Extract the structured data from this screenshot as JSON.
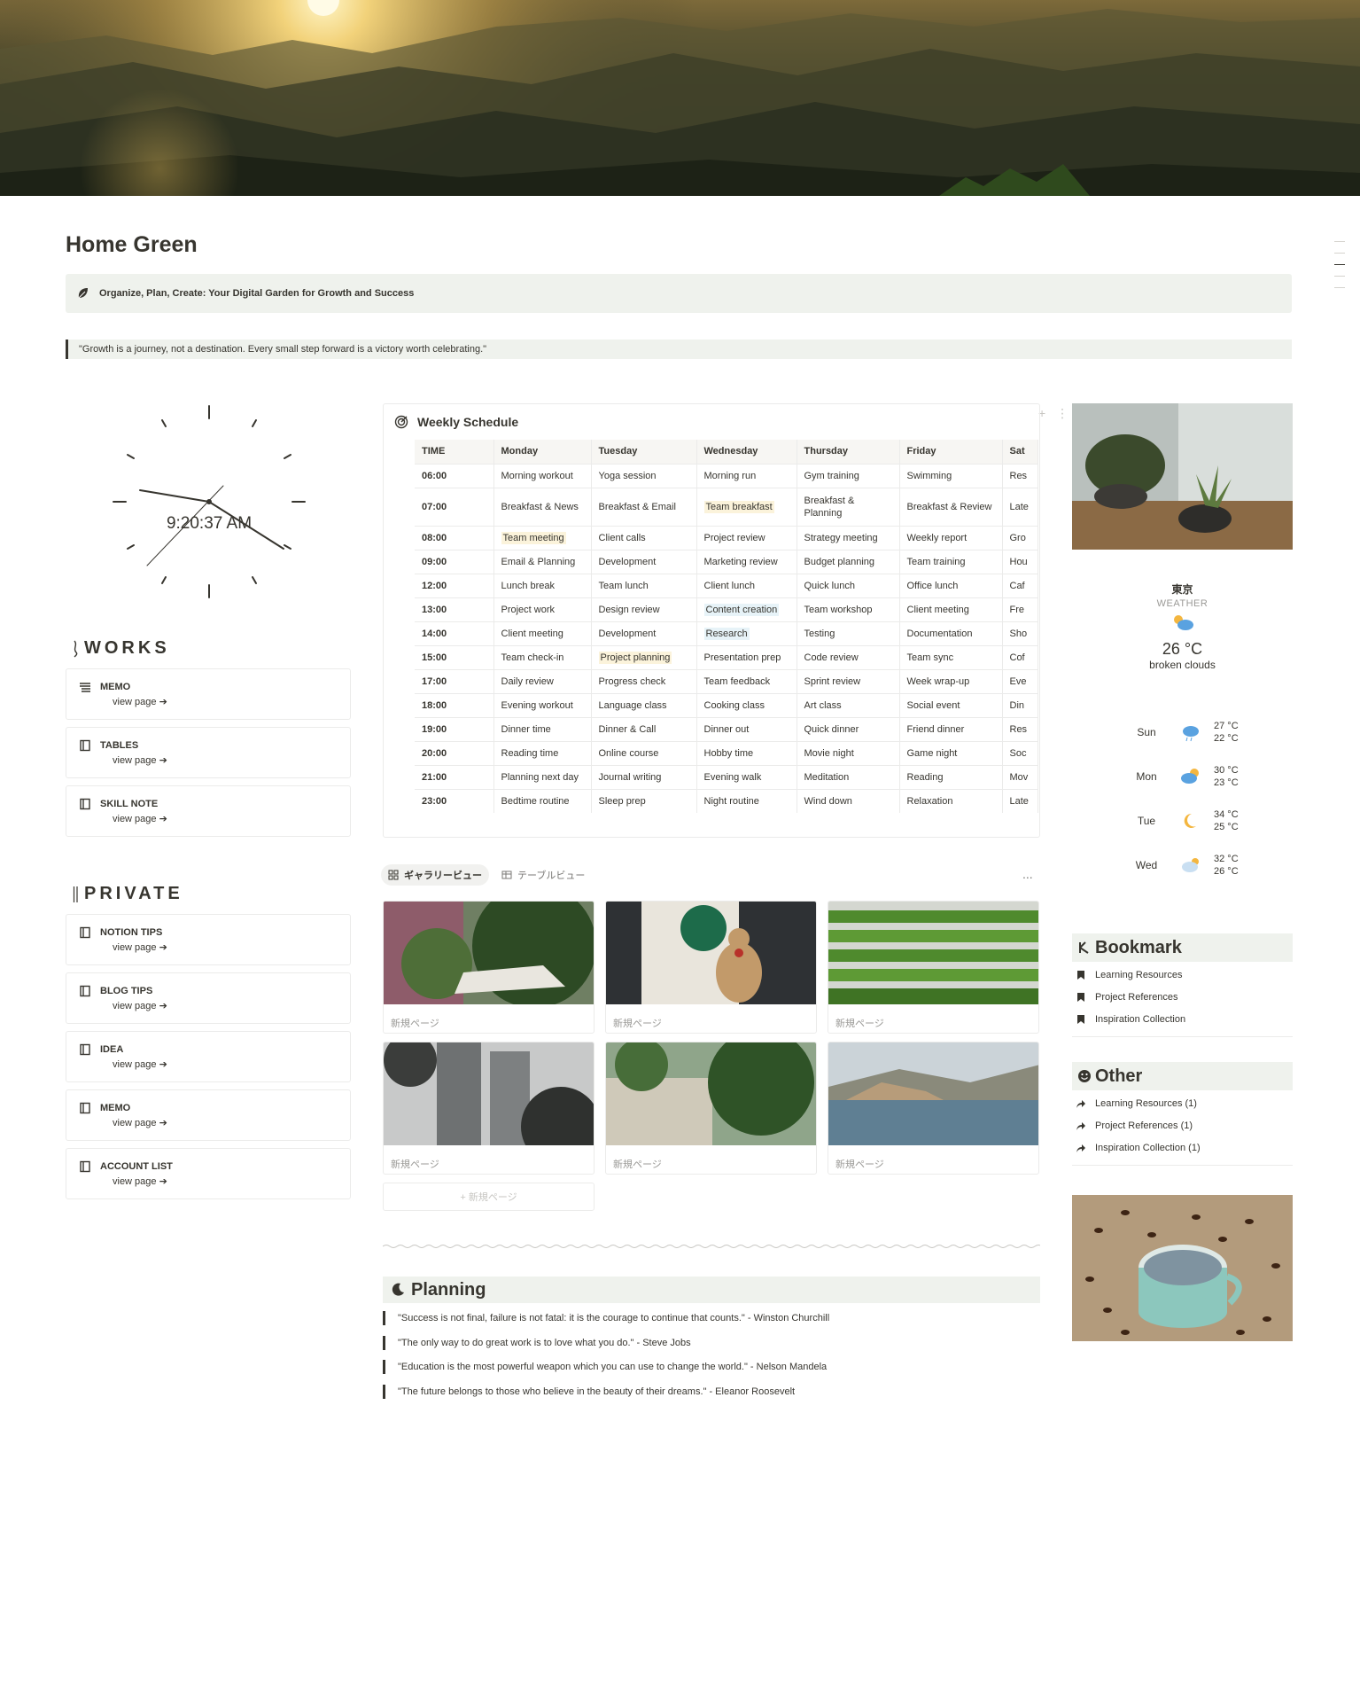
{
  "page": {
    "title": "Home Green",
    "callout": "Organize, Plan, Create: Your Digital Garden for Growth and Success",
    "quote": "\"Growth is a journey, not a destination. Every small step forward is a victory worth celebrating.\""
  },
  "clock": {
    "time": "9:20:37 AM"
  },
  "works": {
    "heading": "WORKS",
    "items": [
      {
        "label": "MEMO",
        "link": "view page ➔",
        "icon": "list-icon"
      },
      {
        "label": "TABLES",
        "link": "view page ➔",
        "icon": "book-icon"
      },
      {
        "label": "SKILL NOTE",
        "link": "view page ➔",
        "icon": "book-icon"
      }
    ]
  },
  "private": {
    "heading": "PRIVATE",
    "items": [
      {
        "label": "NOTION TIPS",
        "link": "view page ➔"
      },
      {
        "label": "BLOG TIPS",
        "link": "view page ➔"
      },
      {
        "label": "IDEA",
        "link": "view page ➔"
      },
      {
        "label": "MEMO",
        "link": "view page ➔"
      },
      {
        "label": "ACCOUNT LIST",
        "link": "view page ➔"
      }
    ]
  },
  "schedule": {
    "title": "Weekly Schedule",
    "headers": [
      "TIME",
      "Monday",
      "Tuesday",
      "Wednesday",
      "Thursday",
      "Friday",
      "Sat"
    ],
    "rows": [
      [
        "06:00",
        "Morning workout",
        "Yoga session",
        "Morning run",
        "Gym training",
        "Swimming",
        "Res"
      ],
      [
        "07:00",
        "Breakfast & News",
        "Breakfast & Email",
        "Team breakfast",
        "Breakfast & Planning",
        "Breakfast & Review",
        "Late"
      ],
      [
        "08:00",
        "Team meeting",
        "Client calls",
        "Project review",
        "Strategy meeting",
        "Weekly report",
        "Gro"
      ],
      [
        "09:00",
        "Email & Planning",
        "Development",
        "Marketing review",
        "Budget planning",
        "Team training",
        "Hou"
      ],
      [
        "12:00",
        "Lunch break",
        "Team lunch",
        "Client lunch",
        "Quick lunch",
        "Office lunch",
        "Caf"
      ],
      [
        "13:00",
        "Project work",
        "Design review",
        "Content creation",
        "Team workshop",
        "Client meeting",
        "Fre"
      ],
      [
        "14:00",
        "Client meeting",
        "Development",
        "Research",
        "Testing",
        "Documentation",
        "Sho"
      ],
      [
        "15:00",
        "Team check-in",
        "Project planning",
        "Presentation prep",
        "Code review",
        "Team sync",
        "Cof"
      ],
      [
        "17:00",
        "Daily review",
        "Progress check",
        "Team feedback",
        "Sprint review",
        "Week wrap-up",
        "Eve"
      ],
      [
        "18:00",
        "Evening workout",
        "Language class",
        "Cooking class",
        "Art class",
        "Social event",
        "Din"
      ],
      [
        "19:00",
        "Dinner time",
        "Dinner & Call",
        "Dinner out",
        "Quick dinner",
        "Friend dinner",
        "Res"
      ],
      [
        "20:00",
        "Reading time",
        "Online course",
        "Hobby time",
        "Movie night",
        "Game night",
        "Soc"
      ],
      [
        "21:00",
        "Planning next day",
        "Journal writing",
        "Evening walk",
        "Meditation",
        "Reading",
        "Mov"
      ],
      [
        "23:00",
        "Bedtime routine",
        "Sleep prep",
        "Night routine",
        "Wind down",
        "Relaxation",
        "Late"
      ]
    ],
    "highlights": {
      "yellow": [
        "1-3",
        "2-1",
        "7-2"
      ],
      "blue": [
        "5-3",
        "6-3"
      ]
    }
  },
  "gallery": {
    "tabs": [
      "ギャラリービュー",
      "テーブルビュー"
    ],
    "more": "...",
    "cards": [
      {
        "caption": "新規ページ"
      },
      {
        "caption": "新規ページ"
      },
      {
        "caption": "新規ページ"
      },
      {
        "caption": "新規ページ"
      },
      {
        "caption": "新規ページ"
      },
      {
        "caption": "新規ページ"
      }
    ],
    "new_page": "+ 新規ページ"
  },
  "planning": {
    "heading": "Planning",
    "quotes": [
      "\"Success is not final, failure is not fatal: it is the courage to continue that counts.\" - Winston Churchill",
      "\"The only way to do great work is to love what you do.\" - Steve Jobs",
      "\"Education is the most powerful weapon which you can use to change the world.\" - Nelson Mandela",
      "\"The future belongs to those who believe in the beauty of their dreams.\" - Eleanor Roosevelt"
    ]
  },
  "weather": {
    "city": "東京",
    "label": "WEATHER",
    "temp": "26 °C",
    "desc": "broken clouds",
    "forecast": [
      {
        "day": "Sun",
        "high": "27 °C",
        "low": "22 °C",
        "icon": "rain-cloud-icon"
      },
      {
        "day": "Mon",
        "high": "30 °C",
        "low": "23 °C",
        "icon": "partly-cloudy-icon"
      },
      {
        "day": "Tue",
        "high": "34 °C",
        "low": "25 °C",
        "icon": "moon-icon"
      },
      {
        "day": "Wed",
        "high": "32 °C",
        "low": "26 °C",
        "icon": "cloudy-icon"
      }
    ]
  },
  "bookmark": {
    "heading": "Bookmark",
    "items": [
      "Learning Resources",
      "Project References",
      "Inspiration Collection"
    ]
  },
  "other": {
    "heading": "Other",
    "items": [
      "Learning Resources (1)",
      "Project References (1)",
      "Inspiration Collection (1)"
    ]
  },
  "colors": {
    "accent_bg": "#eff2ed",
    "text": "#37352f",
    "highlight_yellow": "#fbf3db",
    "highlight_blue": "#e7f3f8"
  }
}
